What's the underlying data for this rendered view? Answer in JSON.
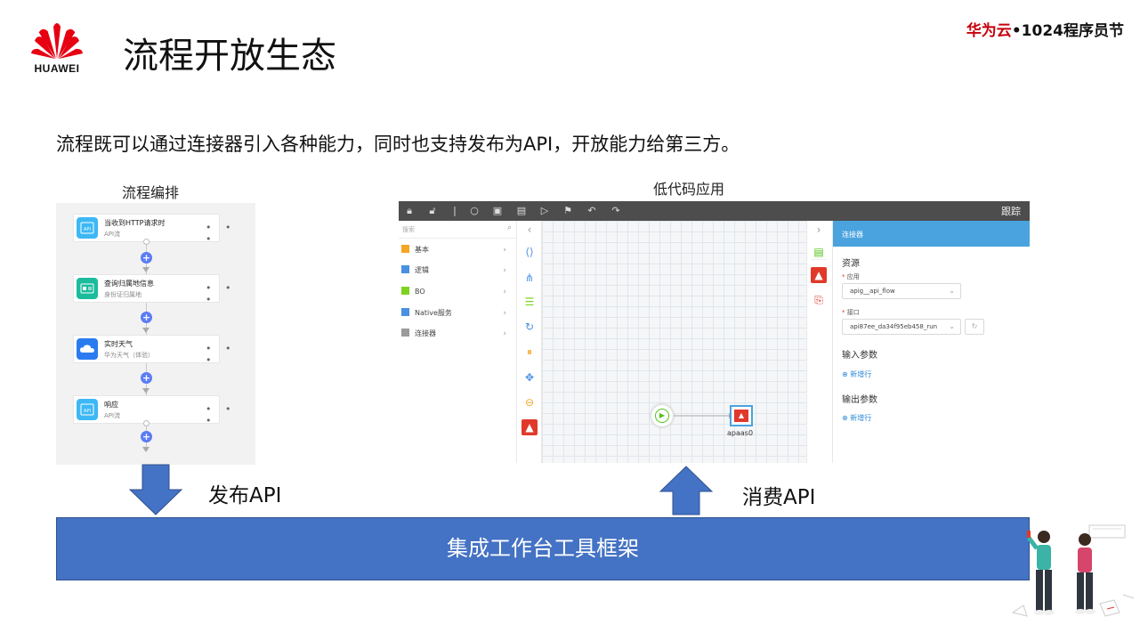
{
  "brand": {
    "logo_text": "HUAWEI",
    "event_red": "华为云",
    "event_dark": "•1024程序员节"
  },
  "title": "流程开放生态",
  "subtitle": "流程既可以通过连接器引入各种能力，同时也支持发布为API，开放能力给第三方。",
  "left_caption": "流程编排",
  "right_caption": "低代码应用",
  "flow": {
    "cards": [
      {
        "title": "当收到HTTP请求时",
        "sub": "API流",
        "icon": "api-icon",
        "color": "#3db8f5"
      },
      {
        "title": "查询归属地信息",
        "sub": "身份证归属地",
        "icon": "id-card-icon",
        "color": "#1abc9c"
      },
      {
        "title": "实时天气",
        "sub": "华为天气（体验）",
        "icon": "cloud-icon",
        "color": "#2b7bf0"
      },
      {
        "title": "响应",
        "sub": "API流",
        "icon": "api-icon",
        "color": "#3db8f5"
      }
    ],
    "more": "• • •"
  },
  "app": {
    "toolbar_right": "跟踪",
    "search_placeholder": "搜索",
    "palette": [
      {
        "label": "基本",
        "icon": "basic-icon",
        "color": "#f5a623"
      },
      {
        "label": "逻辑",
        "icon": "logic-icon",
        "color": "#4a90e2"
      },
      {
        "label": "BO",
        "icon": "bo-icon",
        "color": "#7ed321"
      },
      {
        "label": "Native服务",
        "icon": "native-service-icon",
        "color": "#4a90e2"
      },
      {
        "label": "连接器",
        "icon": "connector-icon",
        "color": "#9b9b9b"
      }
    ],
    "node_label": "apaas0",
    "panel": {
      "header": "连接器",
      "resource": "资源",
      "app_label": "应用",
      "app_value": "apig__api_flow",
      "api_label": "接口",
      "api_value": "api87ee_da34f95eb458_run",
      "input_params": "输入参数",
      "output_params": "输出参数",
      "add_row": "新增行"
    }
  },
  "publish_api": "发布API",
  "consume_api": "消费API",
  "framework": "集成工作台工具框架",
  "colors": {
    "accent_red": "#c7000b",
    "framework_blue": "#4472c4",
    "arrow_blue": "#4472c4"
  }
}
